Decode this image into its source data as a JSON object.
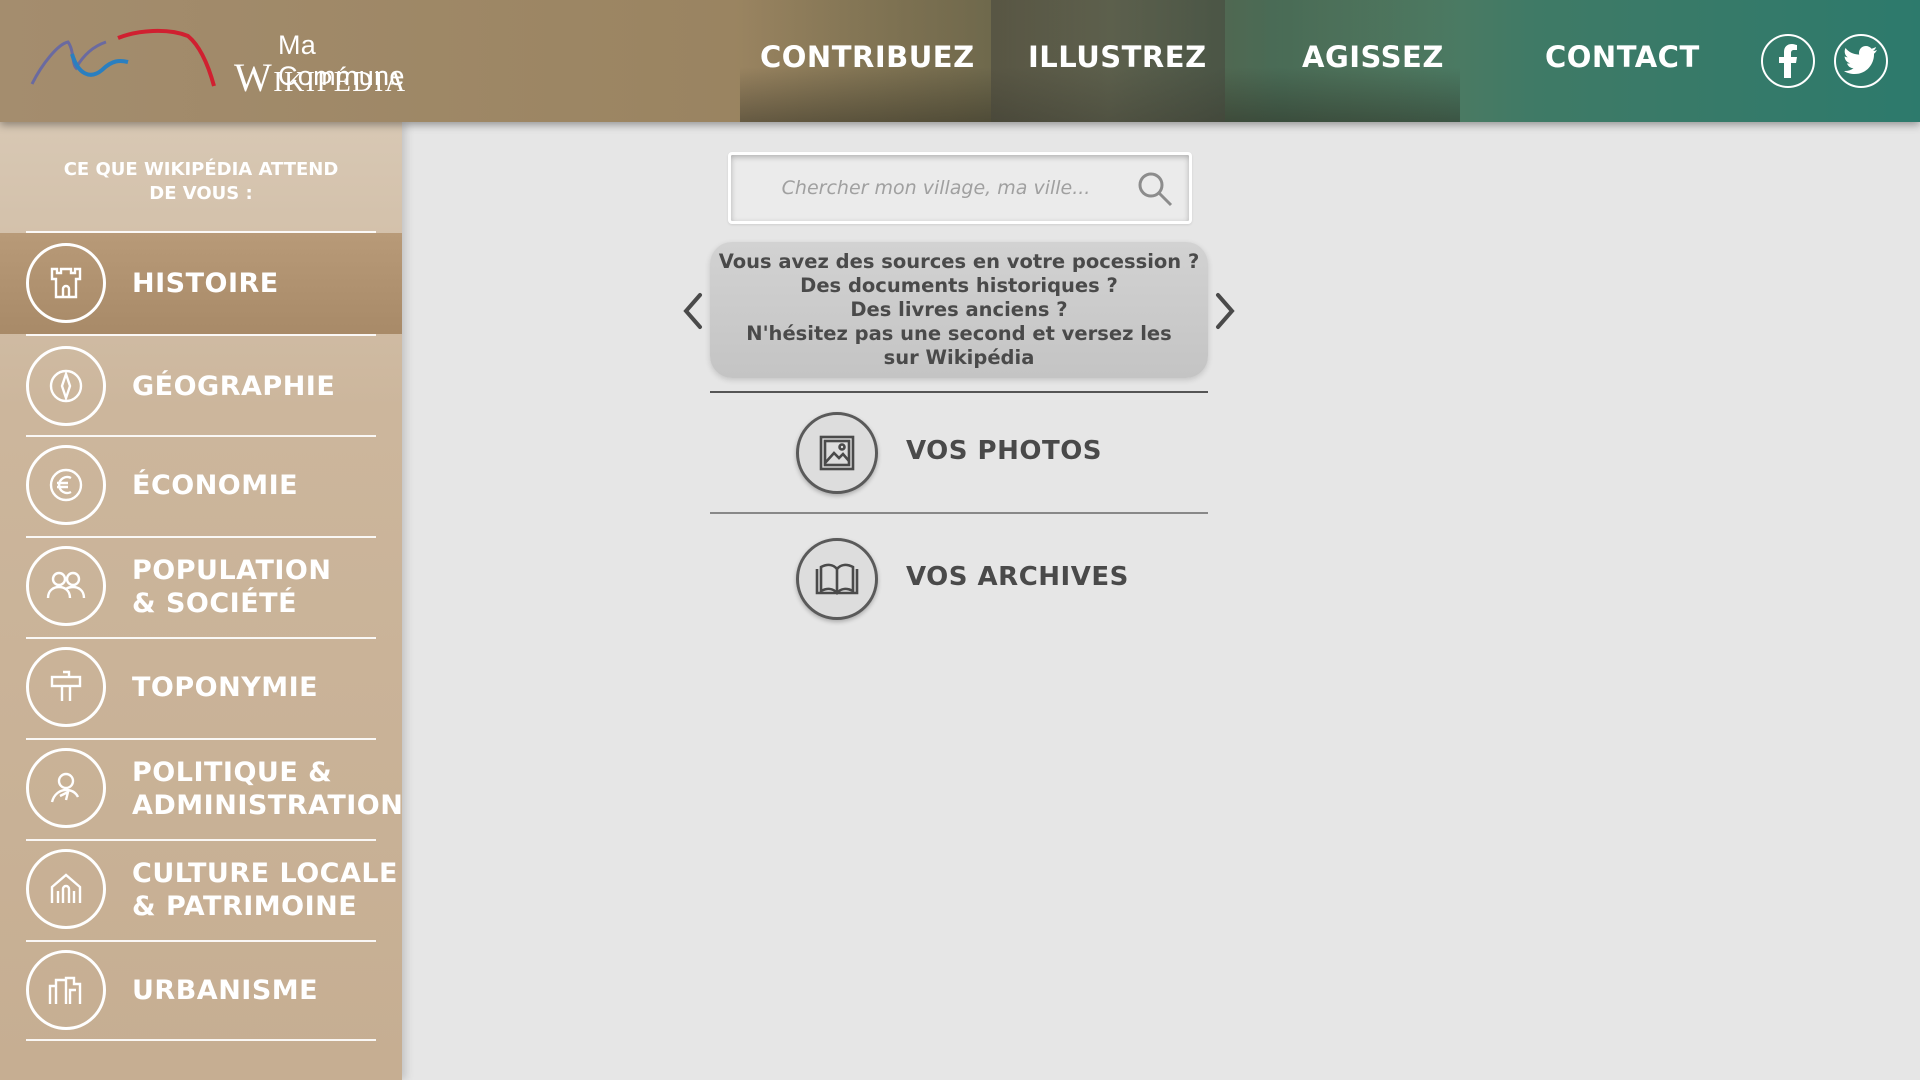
{
  "brand": {
    "line1": "Ma Commune",
    "line2": "Wikipédia",
    "accent_colors": [
      "#2a7fc0",
      "#d02030",
      "#6a6aa0"
    ]
  },
  "nav": {
    "items": [
      {
        "label": "CONTRIBUEZ"
      },
      {
        "label": "ILLUSTREZ"
      },
      {
        "label": "AGISSEZ"
      },
      {
        "label": "CONTACT"
      }
    ],
    "social": [
      {
        "icon": "facebook-icon"
      },
      {
        "icon": "twitter-icon"
      }
    ]
  },
  "sidebar": {
    "heading_line1": "CE QUE WIKIPÉDIA ATTEND",
    "heading_line2": "DE VOUS :",
    "active_index": 0,
    "items": [
      {
        "lines": [
          "HISTOIRE"
        ],
        "icon": "castle-icon"
      },
      {
        "lines": [
          "GÉOGRAPHIE"
        ],
        "icon": "compass-icon"
      },
      {
        "lines": [
          "ÉCONOMIE"
        ],
        "icon": "euro-icon"
      },
      {
        "lines": [
          "POPULATION",
          "& SOCIÉTÉ"
        ],
        "icon": "people-icon"
      },
      {
        "lines": [
          "TOPONYMIE"
        ],
        "icon": "signpost-icon"
      },
      {
        "lines": [
          "POLITIQUE &",
          "ADMINISTRATION"
        ],
        "icon": "person-icon"
      },
      {
        "lines": [
          "CULTURE LOCALE",
          "& PATRIMOINE"
        ],
        "icon": "monument-icon"
      },
      {
        "lines": [
          "URBANISME"
        ],
        "icon": "buildings-icon"
      }
    ]
  },
  "search": {
    "placeholder": "Chercher mon village, ma ville..."
  },
  "carousel": {
    "lines": [
      "Vous avez des sources en votre pocession ?",
      "Des documents historiques ?",
      "Des livres anciens ?",
      "N'hésitez pas une second et versez les",
      "sur Wikipédia"
    ]
  },
  "actions": {
    "photos_label": "VOS PHOTOS",
    "archives_label": "VOS ARCHIVES"
  }
}
